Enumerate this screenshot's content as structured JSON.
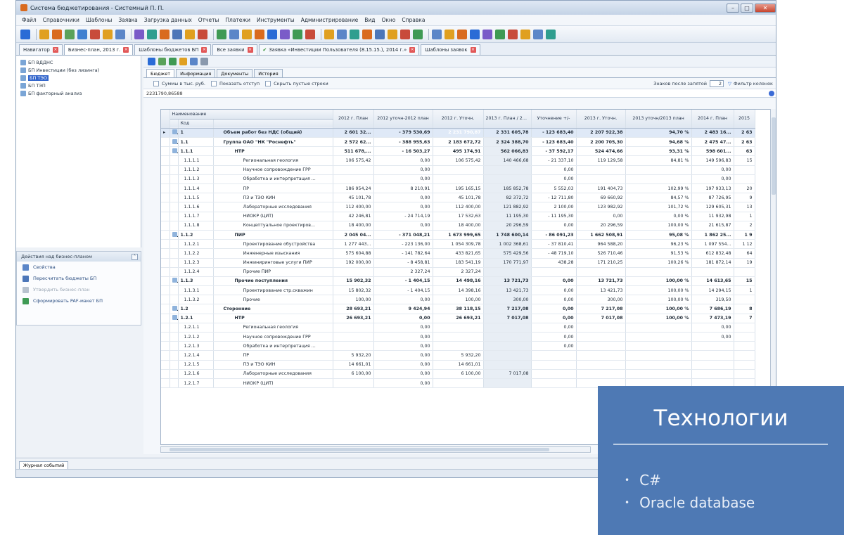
{
  "window": {
    "title": "Система бюджетирования - Системный П. П.",
    "menu": [
      "Файл",
      "Справочники",
      "Шаблоны",
      "Заявка",
      "Загрузка данных",
      "Отчеты",
      "Платежи",
      "Инструменты",
      "Администрирование",
      "Вид",
      "Окно",
      "Справка"
    ]
  },
  "doc_tabs": [
    {
      "label": "Навигатор",
      "active": false,
      "ok": false
    },
    {
      "label": "Бизнес-план, 2013 г.",
      "active": true,
      "ok": false
    },
    {
      "label": "Шаблоны бюджетов БП",
      "active": false,
      "ok": false
    },
    {
      "label": "Все заявки",
      "active": false,
      "ok": false
    },
    {
      "label": "Заявка «Инвестиции Пользователя (8.15.15.), 2014 г.»",
      "active": false,
      "ok": true
    },
    {
      "label": "Шаблоны заявок",
      "active": false,
      "ok": false
    }
  ],
  "nav_tree": [
    {
      "label": "БП ВДДНС",
      "selected": false
    },
    {
      "label": "БП Инвестиции (без лизинга)",
      "selected": false
    },
    {
      "label": "БП ТЭО",
      "selected": true
    },
    {
      "label": "БП ТЭП",
      "selected": false
    },
    {
      "label": "БП факторный анализ",
      "selected": false
    }
  ],
  "actions": {
    "title": "Действия над бизнес-планом",
    "items": [
      {
        "label": "Свойства",
        "disabled": false,
        "color": "#5b86c8"
      },
      {
        "label": "Пересчитать бюджеты БП",
        "disabled": false,
        "color": "#4c76b8"
      },
      {
        "label": "Утвердить бизнес-план",
        "disabled": true,
        "color": "#b8c2ce"
      },
      {
        "label": "Сформировать PAF-макет БП",
        "disabled": false,
        "color": "#3f9a54"
      }
    ]
  },
  "inner_tabs": [
    "Бюджет",
    "Информация",
    "Документы",
    "История"
  ],
  "options": {
    "sum_label": "Суммы в тыс. руб.",
    "indent_label": "Показать отступ",
    "hide_empty_label": "Скрыть пустые строки",
    "decimals_label": "Знаков после запятой",
    "decimals_value": "2",
    "filter_label": "Фильтр колонок"
  },
  "value_bar": "2231790,86588",
  "table": {
    "header_name": "Наименование",
    "header_code": "Код",
    "columns": [
      "2012 г. План",
      "2012 уточн-2012 план",
      "2012 г. Уточн.",
      "2013 г. План / 2013 г. План",
      "Уточнение +/-",
      "2013 г. Уточн.",
      "2013 уточн/2013 план",
      "2014 г. План",
      "2015"
    ],
    "rows": [
      {
        "code": "1",
        "name": "Объем работ без НДС (общий)",
        "bold": true,
        "sel": true,
        "v": [
          "2 601 32...",
          "- 379 530,69",
          "2 231 790,87",
          "2 331 605,78",
          "- 123 683,40",
          "2 207 922,38",
          "94,70 %",
          "2 483 16...",
          "2 63"
        ]
      },
      {
        "code": "1.1",
        "name": "Группа ОАО \"НК \"Роснефть\"",
        "bold": true,
        "v": [
          "2 572 62...",
          "- 388 955,63",
          "2 183 672,72",
          "2 324 388,70",
          "- 123 683,40",
          "2 200 705,30",
          "94,68 %",
          "2 475 47...",
          "2 63"
        ]
      },
      {
        "code": "1.1.1",
        "name": "НТР",
        "bold": true,
        "v": [
          "511 678,...",
          "- 16 503,27",
          "495 174,91",
          "562 066,83",
          "- 37 592,17",
          "524 474,66",
          "93,31 %",
          "598 601...",
          "63"
        ]
      },
      {
        "code": "1.1.1.1",
        "name": "Региональная геология",
        "v": [
          "106 575,42",
          "0,00",
          "106 575,42",
          "140 466,68",
          "- 21 337,10",
          "119 129,58",
          "84,81 %",
          "149 596,83",
          "15"
        ]
      },
      {
        "code": "1.1.1.2",
        "name": "Научное сопровождение ГРР",
        "v": [
          "",
          "0,00",
          "",
          "",
          "0,00",
          "",
          "",
          "0,00",
          ""
        ]
      },
      {
        "code": "1.1.1.3",
        "name": "Обработка и интерпретация ...",
        "v": [
          "",
          "0,00",
          "",
          "",
          "0,00",
          "",
          "",
          "0,00",
          ""
        ]
      },
      {
        "code": "1.1.1.4",
        "name": "ПР",
        "v": [
          "186 954,24",
          "8 210,91",
          "195 165,15",
          "185 852,78",
          "5 552,03",
          "191 404,73",
          "102,99 %",
          "197 933,13",
          "20"
        ]
      },
      {
        "code": "1.1.1.5",
        "name": "ПЗ и ТЭО КИН",
        "v": [
          "45 101,78",
          "0,00",
          "45 101,78",
          "82 372,72",
          "- 12 711,80",
          "69 660,92",
          "84,57 %",
          "87 726,95",
          "9"
        ]
      },
      {
        "code": "1.1.1.6",
        "name": "Лабораторные исследования",
        "v": [
          "112 400,00",
          "0,00",
          "112 400,00",
          "121 882,92",
          "2 100,00",
          "123 982,92",
          "101,72 %",
          "129 605,31",
          "13"
        ]
      },
      {
        "code": "1.1.1.7",
        "name": "НИОКР (ЦИТ)",
        "v": [
          "42 246,81",
          "- 24 714,19",
          "17 532,63",
          "11 195,30",
          "- 11 195,30",
          "0,00",
          "0,00 %",
          "11 932,98",
          "1"
        ]
      },
      {
        "code": "1.1.1.8",
        "name": "Концептуальное проектиров...",
        "v": [
          "18 400,00",
          "0,00",
          "18 400,00",
          "20 296,59",
          "0,00",
          "20 296,59",
          "100,00 %",
          "21 615,87",
          "2"
        ]
      },
      {
        "code": "1.1.2",
        "name": "ПИР",
        "bold": true,
        "v": [
          "2 045 04...",
          "- 371 048,21",
          "1 673 999,65",
          "1 748 600,14",
          "- 86 091,23",
          "1 662 508,91",
          "95,08 %",
          "1 862 25...",
          "1 9"
        ]
      },
      {
        "code": "1.1.2.1",
        "name": "Проектирование обустройства",
        "v": [
          "1 277 443...",
          "- 223 136,00",
          "1 054 309,78",
          "1 002 368,61",
          "- 37 810,41",
          "964 588,20",
          "96,23 %",
          "1 097 554...",
          "1 12"
        ]
      },
      {
        "code": "1.1.2.2",
        "name": "Инженерные изыскания",
        "v": [
          "575 604,88",
          "- 141 782,64",
          "433 821,65",
          "575 429,56",
          "- 48 719,10",
          "526 710,46",
          "91,53 %",
          "612 832,48",
          "64"
        ]
      },
      {
        "code": "1.1.2.3",
        "name": "Инжиниринговые услуги ПИР",
        "v": [
          "192 000,00",
          "- 8 458,81",
          "183 541,19",
          "170 771,97",
          "438,28",
          "171 210,25",
          "100,26 %",
          "181 872,14",
          "19"
        ]
      },
      {
        "code": "1.1.2.4",
        "name": "Прочие ПИР",
        "v": [
          "",
          "2 327,24",
          "2 327,24",
          "",
          "",
          "",
          "",
          "",
          ""
        ]
      },
      {
        "code": "1.1.3",
        "name": "Прочие поступления",
        "bold": true,
        "v": [
          "15 902,32",
          "- 1 404,15",
          "14 498,16",
          "13 721,73",
          "0,00",
          "13 721,73",
          "100,00 %",
          "14 613,65",
          "15"
        ]
      },
      {
        "code": "1.1.3.1",
        "name": "Проектирование стр.скважин",
        "v": [
          "15 802,32",
          "- 1 404,15",
          "14 398,16",
          "13 421,73",
          "0,00",
          "13 421,73",
          "100,00 %",
          "14 294,15",
          "1"
        ]
      },
      {
        "code": "1.1.3.2",
        "name": "Прочие",
        "v": [
          "100,00",
          "0,00",
          "100,00",
          "300,00",
          "0,00",
          "300,00",
          "100,00 %",
          "319,50",
          ""
        ]
      },
      {
        "code": "1.2",
        "name": "Сторонние",
        "bold": true,
        "v": [
          "28 693,21",
          "9 424,94",
          "38 118,15",
          "7 217,08",
          "0,00",
          "7 217,08",
          "100,00 %",
          "7 686,19",
          "8"
        ]
      },
      {
        "code": "1.2.1",
        "name": "НТР",
        "bold": true,
        "v": [
          "26 693,21",
          "0,00",
          "26 693,21",
          "7 017,08",
          "0,00",
          "7 017,08",
          "100,00 %",
          "7 473,19",
          "7"
        ]
      },
      {
        "code": "1.2.1.1",
        "name": "Региональная геология",
        "v": [
          "",
          "0,00",
          "",
          "",
          "0,00",
          "",
          "",
          "0,00",
          ""
        ]
      },
      {
        "code": "1.2.1.2",
        "name": "Научное сопровождение ГРР",
        "v": [
          "",
          "0,00",
          "",
          "",
          "0,00",
          "",
          "",
          "0,00",
          ""
        ]
      },
      {
        "code": "1.2.1.3",
        "name": "Обработка и интерпретация ...",
        "v": [
          "",
          "0,00",
          "",
          "",
          "0,00",
          "",
          "",
          "",
          ""
        ]
      },
      {
        "code": "1.2.1.4",
        "name": "ПР",
        "v": [
          "5 932,20",
          "0,00",
          "5 932,20",
          "",
          "",
          "",
          "",
          "",
          ""
        ]
      },
      {
        "code": "1.2.1.5",
        "name": "ПЗ и ТЭО КИН",
        "v": [
          "14 661,01",
          "0,00",
          "14 661,01",
          "",
          "",
          "",
          "",
          "",
          ""
        ]
      },
      {
        "code": "1.2.1.6",
        "name": "Лабораторные исследования",
        "v": [
          "6 100,00",
          "0,00",
          "6 100,00",
          "7 017,08",
          "",
          "",
          "",
          "",
          ""
        ]
      },
      {
        "code": "1.2.1.7",
        "name": "НИОКР (ЦИТ)",
        "v": [
          "",
          "0,00",
          "",
          "",
          "",
          "",
          "",
          "",
          ""
        ]
      }
    ]
  },
  "journal_tab": "Журнал событий",
  "tech": {
    "title": "Технологии",
    "items": [
      "C#",
      "Oracle database"
    ]
  },
  "colors": {
    "overlay": "#4e79b4",
    "selected_cell": "#2e5fc9"
  }
}
